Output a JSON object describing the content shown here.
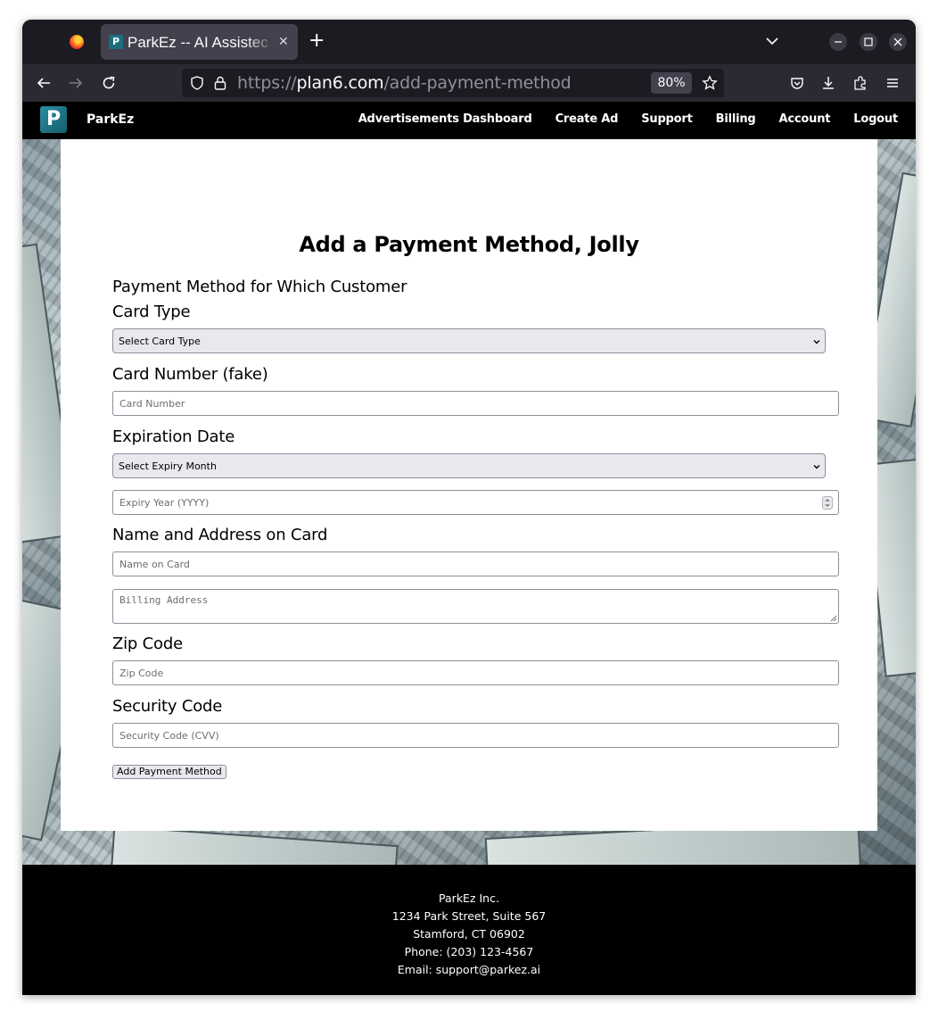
{
  "browser": {
    "tab_title": "ParkEz -- AI Assistec",
    "tab_favicon_letter": "P",
    "url_prefix": "https://",
    "url_host": "plan6.com",
    "url_path": "/add-payment-method",
    "zoom": "80%"
  },
  "site": {
    "logo_letter": "P",
    "brand": "ParkEz",
    "nav": [
      "Advertisements Dashboard",
      "Create Ad",
      "Support",
      "Billing",
      "Account",
      "Logout"
    ]
  },
  "form": {
    "title": "Add a Payment Method, Jolly",
    "customer_label": "Payment Method for Which Customer",
    "card_type_label": "Card Type",
    "card_type_select": "Select Card Type",
    "card_number_label": "Card Number (fake)",
    "card_number_placeholder": "Card Number",
    "expiration_label": "Expiration Date",
    "expiry_month_select": "Select Expiry Month",
    "expiry_year_placeholder": "Expiry Year (YYYY)",
    "name_address_label": "Name and Address on Card",
    "name_placeholder": "Name on Card",
    "billing_placeholder": "Billing Address",
    "zip_label": "Zip Code",
    "zip_placeholder": "Zip Code",
    "security_label": "Security Code",
    "security_placeholder": "Security Code (CVV)",
    "submit_label": "Add Payment Method"
  },
  "footer": {
    "company": "ParkEz Inc.",
    "street": "1234 Park Street, Suite 567",
    "city": "Stamford, CT 06902",
    "phone": "Phone: (203) 123-4567",
    "email": "Email: support@parkez.ai"
  }
}
